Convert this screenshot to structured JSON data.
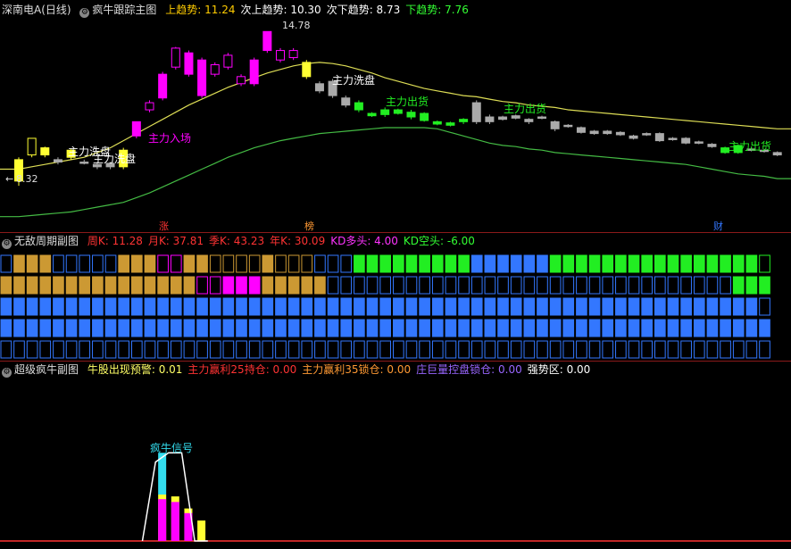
{
  "main": {
    "stock_name": "深南电A(日线)",
    "indicator_name": "疯牛跟踪主图",
    "labels": [
      {
        "key": "上趋势",
        "value": "11.24",
        "color": "#ffcc00"
      },
      {
        "key": "次上趋势",
        "value": "10.30",
        "color": "#ffffff"
      },
      {
        "key": "次下趋势",
        "value": "8.73",
        "color": "#ffffff"
      },
      {
        "key": "下趋势",
        "value": "7.76",
        "color": "#33ff33"
      }
    ],
    "high_mark": "14.78",
    "low_mark": "8.32",
    "annotations": [
      "主力洗盘",
      "主力洗盘",
      "主力入场",
      "主力洗盘",
      "主力出货",
      "主力出货",
      "主力出货"
    ],
    "bottom_marks": [
      "涨",
      "榜",
      "财"
    ]
  },
  "sub1": {
    "name": "无敌周期副图",
    "labels": [
      {
        "key": "周K",
        "value": "11.28",
        "color": "#ff3333"
      },
      {
        "key": "月K",
        "value": "37.81",
        "color": "#ff3333"
      },
      {
        "key": "季K",
        "value": "43.23",
        "color": "#ff3333"
      },
      {
        "key": "年K",
        "value": "30.09",
        "color": "#ff3333"
      },
      {
        "key": "KD多头",
        "value": "4.00",
        "color": "#ff33ff"
      },
      {
        "key": "KD空头",
        "value": "-6.00",
        "color": "#33ff33"
      }
    ]
  },
  "sub2": {
    "name": "超级疯牛副图",
    "labels": [
      {
        "key": "牛股出现预警",
        "value": "0.01",
        "color": "#ffff66"
      },
      {
        "key": "主力赢利25持仓",
        "value": "0.00",
        "color": "#ff3333"
      },
      {
        "key": "主力赢利35锁仓",
        "value": "0.00",
        "color": "#ff9933"
      },
      {
        "key": "庄巨量控盘锁仓",
        "value": "0.00",
        "color": "#9966ff"
      },
      {
        "key": "强势区",
        "value": "0.00",
        "color": "#ffffff"
      }
    ],
    "signal_label": "疯牛信号"
  },
  "colors": {
    "up": "#ff00ff",
    "down": "#aaaaaa",
    "yellow": "#ffff33",
    "green": "#22ee22",
    "orange": "#cc9933",
    "blue": "#3377ff",
    "cyan": "#33ddee",
    "line_yellow": "#dddd55",
    "line_green": "#44bb44"
  },
  "chart_data": {
    "type": "candlestick",
    "candles": [
      {
        "o": 8.5,
        "c": 9.4,
        "h": 9.5,
        "l": 8.3,
        "k": "y"
      },
      {
        "o": 9.6,
        "c": 10.3,
        "h": 10.3,
        "l": 9.5,
        "k": "yo"
      },
      {
        "o": 9.6,
        "c": 9.9,
        "h": 9.95,
        "l": 9.5,
        "k": "y"
      },
      {
        "o": 9.3,
        "c": 9.4,
        "h": 9.5,
        "l": 9.2,
        "k": "d"
      },
      {
        "o": 9.5,
        "c": 9.8,
        "h": 9.85,
        "l": 9.4,
        "k": "y"
      },
      {
        "o": 9.3,
        "c": 9.25,
        "h": 9.4,
        "l": 9.2,
        "k": "d"
      },
      {
        "o": 9.2,
        "c": 9.1,
        "h": 9.3,
        "l": 9.0,
        "k": "d"
      },
      {
        "o": 9.1,
        "c": 9.25,
        "h": 9.3,
        "l": 9.0,
        "k": "d"
      },
      {
        "o": 9.1,
        "c": 9.8,
        "h": 9.9,
        "l": 9.0,
        "k": "y"
      },
      {
        "o": 10.4,
        "c": 11.0,
        "h": 11.0,
        "l": 10.3,
        "k": "m"
      },
      {
        "o": 11.5,
        "c": 11.8,
        "h": 11.9,
        "l": 11.4,
        "k": "mo"
      },
      {
        "o": 12.0,
        "c": 13.0,
        "h": 13.1,
        "l": 11.9,
        "k": "m"
      },
      {
        "o": 13.3,
        "c": 14.1,
        "h": 14.15,
        "l": 13.2,
        "k": "mo"
      },
      {
        "o": 13.0,
        "c": 13.9,
        "h": 14.0,
        "l": 12.9,
        "k": "m"
      },
      {
        "o": 12.1,
        "c": 13.6,
        "h": 13.7,
        "l": 12.0,
        "k": "m"
      },
      {
        "o": 13.0,
        "c": 13.4,
        "h": 13.5,
        "l": 12.9,
        "k": "mo"
      },
      {
        "o": 13.3,
        "c": 13.8,
        "h": 13.9,
        "l": 13.2,
        "k": "mo"
      },
      {
        "o": 12.6,
        "c": 12.9,
        "h": 13.0,
        "l": 12.5,
        "k": "mo"
      },
      {
        "o": 12.6,
        "c": 13.6,
        "h": 13.7,
        "l": 12.5,
        "k": "m"
      },
      {
        "o": 14.0,
        "c": 14.8,
        "h": 14.8,
        "l": 13.9,
        "k": "m"
      },
      {
        "o": 13.6,
        "c": 14.0,
        "h": 14.1,
        "l": 13.5,
        "k": "mo"
      },
      {
        "o": 13.7,
        "c": 14.0,
        "h": 14.1,
        "l": 13.6,
        "k": "mo"
      },
      {
        "o": 13.5,
        "c": 12.9,
        "h": 13.6,
        "l": 12.8,
        "k": "y"
      },
      {
        "o": 12.6,
        "c": 12.3,
        "h": 12.7,
        "l": 12.2,
        "k": "d"
      },
      {
        "o": 12.7,
        "c": 12.1,
        "h": 12.8,
        "l": 12.0,
        "k": "d"
      },
      {
        "o": 12.0,
        "c": 11.7,
        "h": 12.1,
        "l": 11.6,
        "k": "d"
      },
      {
        "o": 11.8,
        "c": 11.5,
        "h": 11.9,
        "l": 11.4,
        "k": "g"
      },
      {
        "o": 11.35,
        "c": 11.25,
        "h": 11.4,
        "l": 11.2,
        "k": "g"
      },
      {
        "o": 11.5,
        "c": 11.3,
        "h": 11.6,
        "l": 11.2,
        "k": "g"
      },
      {
        "o": 11.5,
        "c": 11.35,
        "h": 11.55,
        "l": 11.3,
        "k": "g"
      },
      {
        "o": 11.4,
        "c": 11.2,
        "h": 11.5,
        "l": 11.1,
        "k": "g"
      },
      {
        "o": 11.35,
        "c": 11.05,
        "h": 11.4,
        "l": 11.0,
        "k": "g"
      },
      {
        "o": 11.0,
        "c": 10.9,
        "h": 11.05,
        "l": 10.85,
        "k": "g"
      },
      {
        "o": 10.95,
        "c": 10.85,
        "h": 11.0,
        "l": 10.8,
        "k": "g"
      },
      {
        "o": 11.1,
        "c": 11.0,
        "h": 11.15,
        "l": 10.9,
        "k": "g"
      },
      {
        "o": 11.8,
        "c": 11.0,
        "h": 11.9,
        "l": 10.9,
        "k": "d"
      },
      {
        "o": 11.2,
        "c": 11.0,
        "h": 11.3,
        "l": 10.9,
        "k": "d"
      },
      {
        "o": 11.1,
        "c": 11.2,
        "h": 11.25,
        "l": 11.05,
        "k": "d"
      },
      {
        "o": 11.25,
        "c": 11.15,
        "h": 11.3,
        "l": 11.1,
        "k": "d"
      },
      {
        "o": 11.1,
        "c": 11.0,
        "h": 11.15,
        "l": 10.9,
        "k": "d"
      },
      {
        "o": 11.2,
        "c": 11.15,
        "h": 11.25,
        "l": 11.1,
        "k": "d"
      },
      {
        "o": 11.0,
        "c": 10.7,
        "h": 11.05,
        "l": 10.6,
        "k": "d"
      },
      {
        "o": 10.85,
        "c": 10.8,
        "h": 10.9,
        "l": 10.75,
        "k": "d"
      },
      {
        "o": 10.75,
        "c": 10.55,
        "h": 10.8,
        "l": 10.5,
        "k": "d"
      },
      {
        "o": 10.6,
        "c": 10.5,
        "h": 10.65,
        "l": 10.45,
        "k": "d"
      },
      {
        "o": 10.6,
        "c": 10.5,
        "h": 10.65,
        "l": 10.45,
        "k": "d"
      },
      {
        "o": 10.55,
        "c": 10.45,
        "h": 10.6,
        "l": 10.4,
        "k": "d"
      },
      {
        "o": 10.4,
        "c": 10.3,
        "h": 10.45,
        "l": 10.25,
        "k": "d"
      },
      {
        "o": 10.5,
        "c": 10.45,
        "h": 10.55,
        "l": 10.4,
        "k": "d"
      },
      {
        "o": 10.5,
        "c": 10.2,
        "h": 10.55,
        "l": 10.15,
        "k": "d"
      },
      {
        "o": 10.3,
        "c": 10.25,
        "h": 10.35,
        "l": 10.2,
        "k": "d"
      },
      {
        "o": 10.3,
        "c": 10.1,
        "h": 10.35,
        "l": 10.05,
        "k": "d"
      },
      {
        "o": 10.15,
        "c": 10.1,
        "h": 10.2,
        "l": 10.05,
        "k": "d"
      },
      {
        "o": 10.05,
        "c": 9.95,
        "h": 10.1,
        "l": 9.9,
        "k": "d"
      },
      {
        "o": 9.9,
        "c": 9.7,
        "h": 9.95,
        "l": 9.65,
        "k": "g"
      },
      {
        "o": 10.0,
        "c": 9.7,
        "h": 10.05,
        "l": 9.65,
        "k": "g"
      },
      {
        "o": 9.85,
        "c": 9.8,
        "h": 9.9,
        "l": 9.75,
        "k": "d"
      },
      {
        "o": 9.8,
        "c": 9.75,
        "h": 9.85,
        "l": 9.7,
        "k": "d"
      },
      {
        "o": 9.7,
        "c": 9.6,
        "h": 9.75,
        "l": 9.55,
        "k": "d"
      }
    ],
    "ma_yellow": [
      9.0,
      9.1,
      9.2,
      9.3,
      9.4,
      9.5,
      9.7,
      9.9,
      10.2,
      10.5,
      10.8,
      11.1,
      11.4,
      11.7,
      11.95,
      12.2,
      12.45,
      12.65,
      12.85,
      13.05,
      13.2,
      13.35,
      13.45,
      13.5,
      13.45,
      13.35,
      13.2,
      13.05,
      12.85,
      12.7,
      12.55,
      12.4,
      12.3,
      12.2,
      12.1,
      12.05,
      11.95,
      11.85,
      11.8,
      11.7,
      11.65,
      11.6,
      11.5,
      11.45,
      11.4,
      11.35,
      11.3,
      11.25,
      11.2,
      11.15,
      11.1,
      11.05,
      11.0,
      10.95,
      10.9,
      10.85,
      10.8,
      10.75,
      10.7
    ],
    "ma_green": [
      7.0,
      7.05,
      7.1,
      7.15,
      7.2,
      7.3,
      7.4,
      7.5,
      7.6,
      7.8,
      8.0,
      8.25,
      8.5,
      8.75,
      9.0,
      9.25,
      9.5,
      9.7,
      9.9,
      10.05,
      10.2,
      10.3,
      10.4,
      10.5,
      10.55,
      10.6,
      10.65,
      10.7,
      10.75,
      10.75,
      10.75,
      10.75,
      10.7,
      10.55,
      10.4,
      10.25,
      10.1,
      10.0,
      9.95,
      9.85,
      9.8,
      9.7,
      9.65,
      9.6,
      9.55,
      9.5,
      9.45,
      9.4,
      9.35,
      9.3,
      9.25,
      9.2,
      9.1,
      9.0,
      8.9,
      8.8,
      8.75,
      8.7,
      8.6
    ],
    "ylim": [
      6.8,
      15.3
    ],
    "signal_bars": [
      {
        "i": 11,
        "cyan": 0.95,
        "yellow": 0.5,
        "magenta": 0.45
      },
      {
        "i": 12,
        "cyan": 0,
        "yellow": 0.48,
        "magenta": 0.42
      },
      {
        "i": 13,
        "cyan": 0,
        "yellow": 0.35,
        "magenta": 0.3
      },
      {
        "i": 14,
        "cyan": 0,
        "yellow": 0.22,
        "magenta": 0.0
      }
    ],
    "signal_line": [
      [
        10,
        0
      ],
      [
        11,
        0.85
      ],
      [
        12,
        0.95
      ],
      [
        13,
        0.95
      ],
      [
        14,
        0
      ],
      [
        15,
        0
      ]
    ]
  }
}
